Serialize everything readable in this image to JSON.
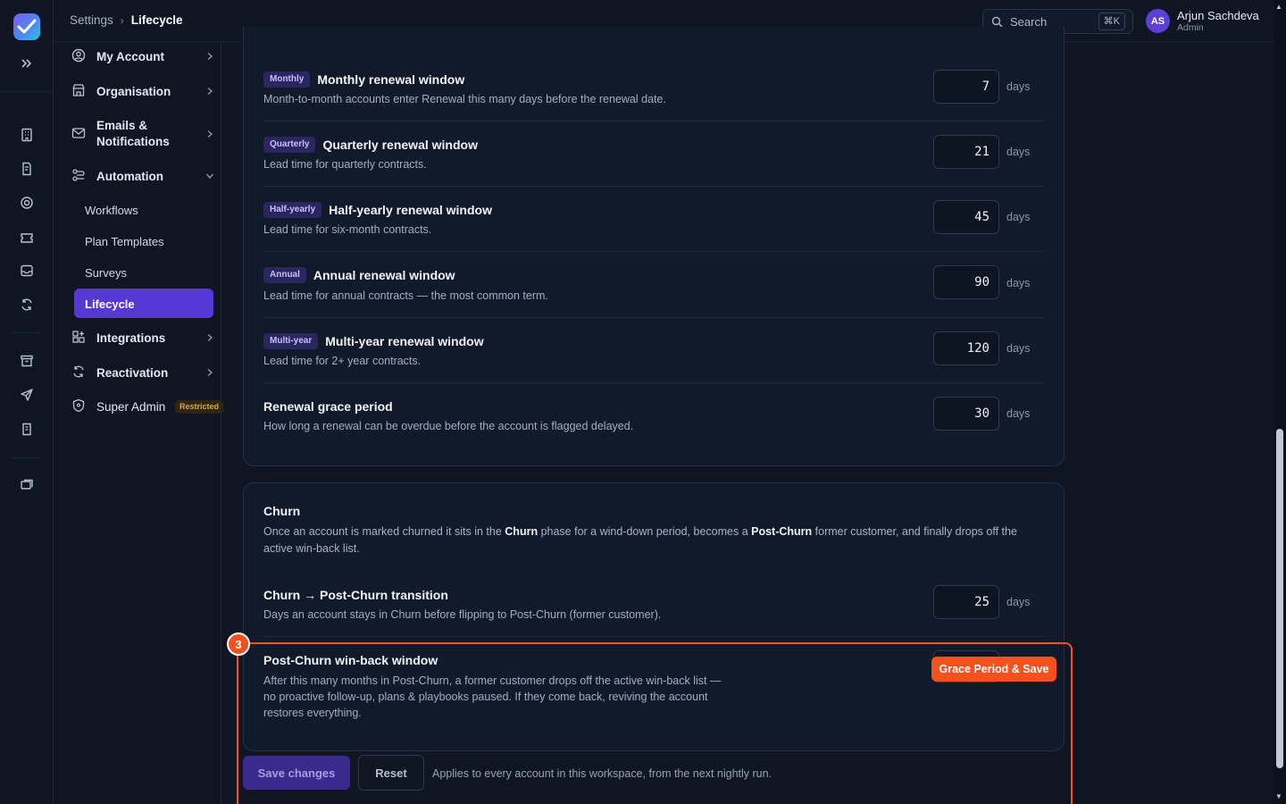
{
  "breadcrumb": {
    "parent": "Settings",
    "current": "Lifecycle"
  },
  "search": {
    "placeholder": "Search",
    "shortcut": "⌘K"
  },
  "user": {
    "initials": "AS",
    "name": "Arjun Sachdeva",
    "role": "Admin"
  },
  "sidebar": {
    "items": [
      {
        "label": "My Account"
      },
      {
        "label": "Organisation"
      },
      {
        "label": "Emails &",
        "label2": "Notifications"
      },
      {
        "label": "Automation"
      },
      {
        "label": "Integrations"
      },
      {
        "label": "Reactivation"
      },
      {
        "label": "Super Admin",
        "badge": "Restricted"
      }
    ],
    "automation_sub": [
      "Workflows",
      "Plan Templates",
      "Surveys",
      "Lifecycle"
    ]
  },
  "renewal": {
    "unit": "days",
    "rows": [
      {
        "badge": "Monthly",
        "title": "Monthly renewal window",
        "desc": "Month-to-month accounts enter Renewal this many days before the renewal date.",
        "value": "7"
      },
      {
        "badge": "Quarterly",
        "title": "Quarterly renewal window",
        "desc": "Lead time for quarterly contracts.",
        "value": "21"
      },
      {
        "badge": "Half-yearly",
        "title": "Half-yearly renewal window",
        "desc": "Lead time for six-month contracts.",
        "value": "45"
      },
      {
        "badge": "Annual",
        "title": "Annual renewal window",
        "desc": "Lead time for annual contracts — the most common term.",
        "value": "90"
      },
      {
        "badge": "Multi-year",
        "title": "Multi-year renewal window",
        "desc": "Lead time for 2+ year contracts.",
        "value": "120"
      },
      {
        "badge": "",
        "title": "Renewal grace period",
        "desc": "How long a renewal can be overdue before the account is flagged delayed.",
        "value": "30"
      }
    ]
  },
  "churn": {
    "heading": "Churn",
    "body_1": "Once an account is marked churned it sits in the ",
    "body_b1": "Churn",
    "body_2": " phase for a wind-down period, becomes a ",
    "body_b2": "Post-Churn",
    "body_3": " former customer, and finally drops off the active win-back list.",
    "transition": {
      "title": "Churn → Post-Churn transition",
      "desc": "Days an account stays in Churn before flipping to Post-Churn (former customer).",
      "value": "25",
      "unit": "days"
    },
    "winback": {
      "title": "Post-Churn win-back window",
      "desc": "After this many months in Post-Churn, a former customer drops off the active win-back list — no proactive follow-up, plans & playbooks paused. If they come back, reviving the account restores everything."
    }
  },
  "tutorial": {
    "step": "3",
    "action_label": "Grace Period & Save"
  },
  "actions": {
    "save": "Save changes",
    "reset": "Reset",
    "note": "Applies to every account in this workspace, from the next nightly run."
  },
  "colors": {
    "accent": "#5638d6",
    "highlight": "#f4511e",
    "background": "#0f1523"
  }
}
